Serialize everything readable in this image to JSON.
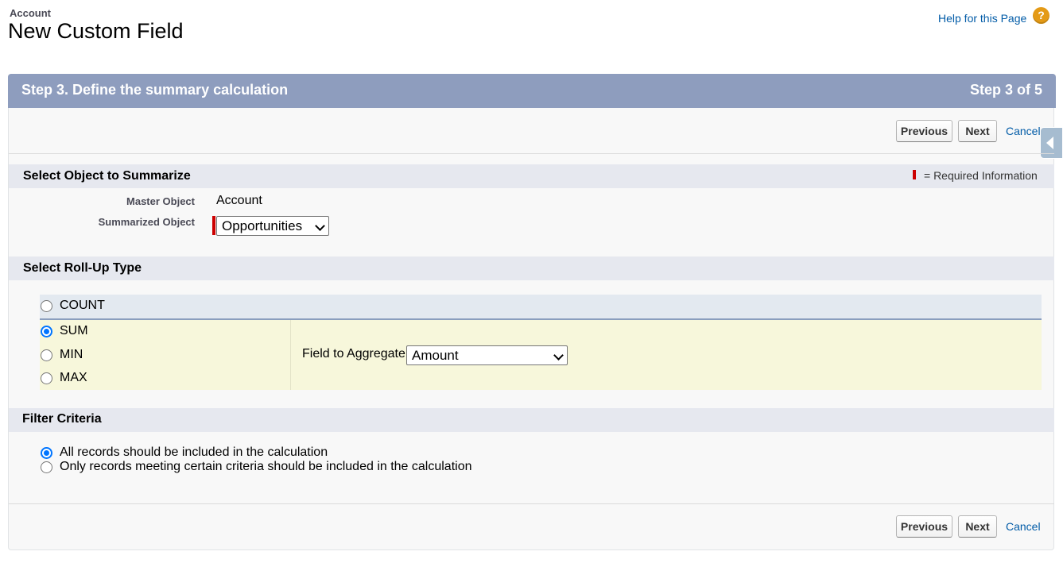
{
  "header": {
    "object_label": "Account",
    "title": "New Custom Field",
    "help_link": "Help for this Page",
    "help_icon": "question-circle-icon"
  },
  "step": {
    "title": "Step 3. Define the summary calculation",
    "count": "Step 3 of 5"
  },
  "nav": {
    "previous": "Previous",
    "next": "Next",
    "cancel": "Cancel"
  },
  "section_object": {
    "title": "Select Object to Summarize",
    "required_info": "= Required Information",
    "master_label": "Master Object",
    "master_value": "Account",
    "summarized_label": "Summarized Object",
    "summarized_value": "Opportunities"
  },
  "section_rollup": {
    "title": "Select Roll-Up Type",
    "options": [
      {
        "label": "COUNT",
        "checked": false
      },
      {
        "label": "SUM",
        "checked": true
      },
      {
        "label": "MIN",
        "checked": false
      },
      {
        "label": "MAX",
        "checked": false
      }
    ],
    "field_label": "Field to Aggregate",
    "field_value": "Amount"
  },
  "section_filter": {
    "title": "Filter Criteria",
    "options": [
      {
        "label": "All records should be included in the calculation",
        "checked": true
      },
      {
        "label": "Only records meeting certain criteria should be included in the calculation",
        "checked": false
      }
    ]
  },
  "colors": {
    "step_header": "#8e9dbe",
    "link": "#015ba7",
    "required": "#cc0000",
    "radio_checked": "#0075ff"
  }
}
